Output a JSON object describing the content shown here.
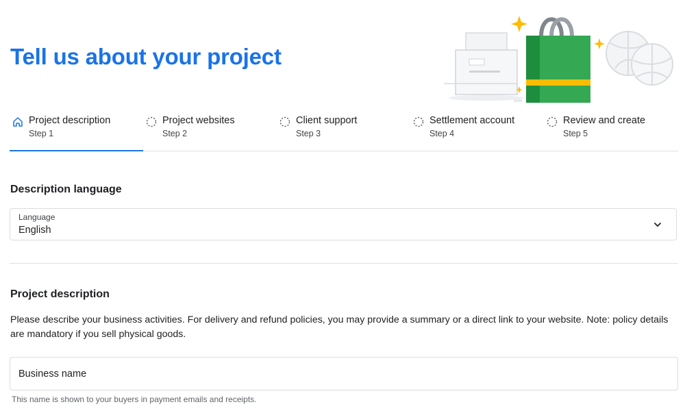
{
  "page": {
    "title": "Tell us about your project"
  },
  "illustration": {
    "name": "shopping-illustration"
  },
  "stepper": {
    "active_index": 0,
    "steps": [
      {
        "label": "Project description",
        "sub": "Step 1",
        "icon": "home-icon",
        "state": "active"
      },
      {
        "label": "Project websites",
        "sub": "Step 2",
        "icon": "dashed-circle-icon",
        "state": "pending"
      },
      {
        "label": "Client support",
        "sub": "Step 3",
        "icon": "dashed-circle-icon",
        "state": "pending"
      },
      {
        "label": "Settlement account",
        "sub": "Step 4",
        "icon": "dashed-circle-icon",
        "state": "pending"
      },
      {
        "label": "Review and create",
        "sub": "Step 5",
        "icon": "dashed-circle-icon",
        "state": "pending"
      }
    ]
  },
  "language_section": {
    "heading": "Description language",
    "field_caption": "Language",
    "value": "English",
    "icon": "chevron-down-icon"
  },
  "project_section": {
    "heading": "Project description",
    "text": "Please describe your business activities. For delivery and refund policies, you may provide a summary or a direct link to your website. Note: policy details are mandatory if you sell physical goods.",
    "business_name": {
      "placeholder": "Business name",
      "value": ""
    },
    "helper": "This name is shown to your buyers in payment emails and receipts."
  },
  "colors": {
    "accent": "#1a73e8",
    "bag_green": "#34a853",
    "bag_yellow": "#fbbc04"
  }
}
